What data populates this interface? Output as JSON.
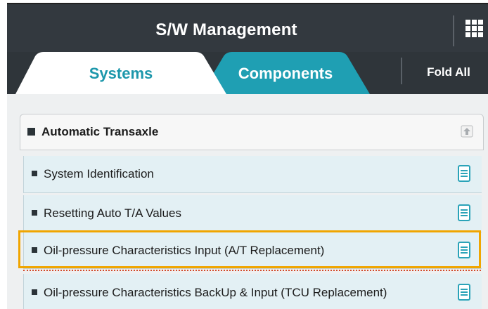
{
  "header": {
    "title": "S/W Management",
    "menu_icon": "grid-menu-icon"
  },
  "tabs": {
    "items": [
      {
        "label": "Systems",
        "active": true
      },
      {
        "label": "Components",
        "active": false
      }
    ],
    "fold_all_label": "Fold All"
  },
  "group": {
    "label": "Automatic Transaxle",
    "collapse_icon": "collapse-up-icon"
  },
  "items": [
    {
      "label": "System Identification",
      "icon": "document-icon",
      "highlighted": false
    },
    {
      "label": "Resetting Auto T/A Values",
      "icon": "document-icon",
      "highlighted": false
    },
    {
      "label": "Oil-pressure Characteristics Input (A/T Replacement)",
      "icon": "document-icon",
      "highlighted": true
    },
    {
      "label": "Oil-pressure Characteristics BackUp & Input (TCU Replacement)",
      "icon": "document-icon",
      "highlighted": false
    }
  ],
  "colors": {
    "header_bg": "#33393f",
    "tab_active_text": "#1c97ab",
    "tab_inactive_bg": "#1f9fb3",
    "item_bg": "#e3f0f4",
    "doc_icon": "#2aa3b8",
    "highlight_border": "#f0a500"
  }
}
